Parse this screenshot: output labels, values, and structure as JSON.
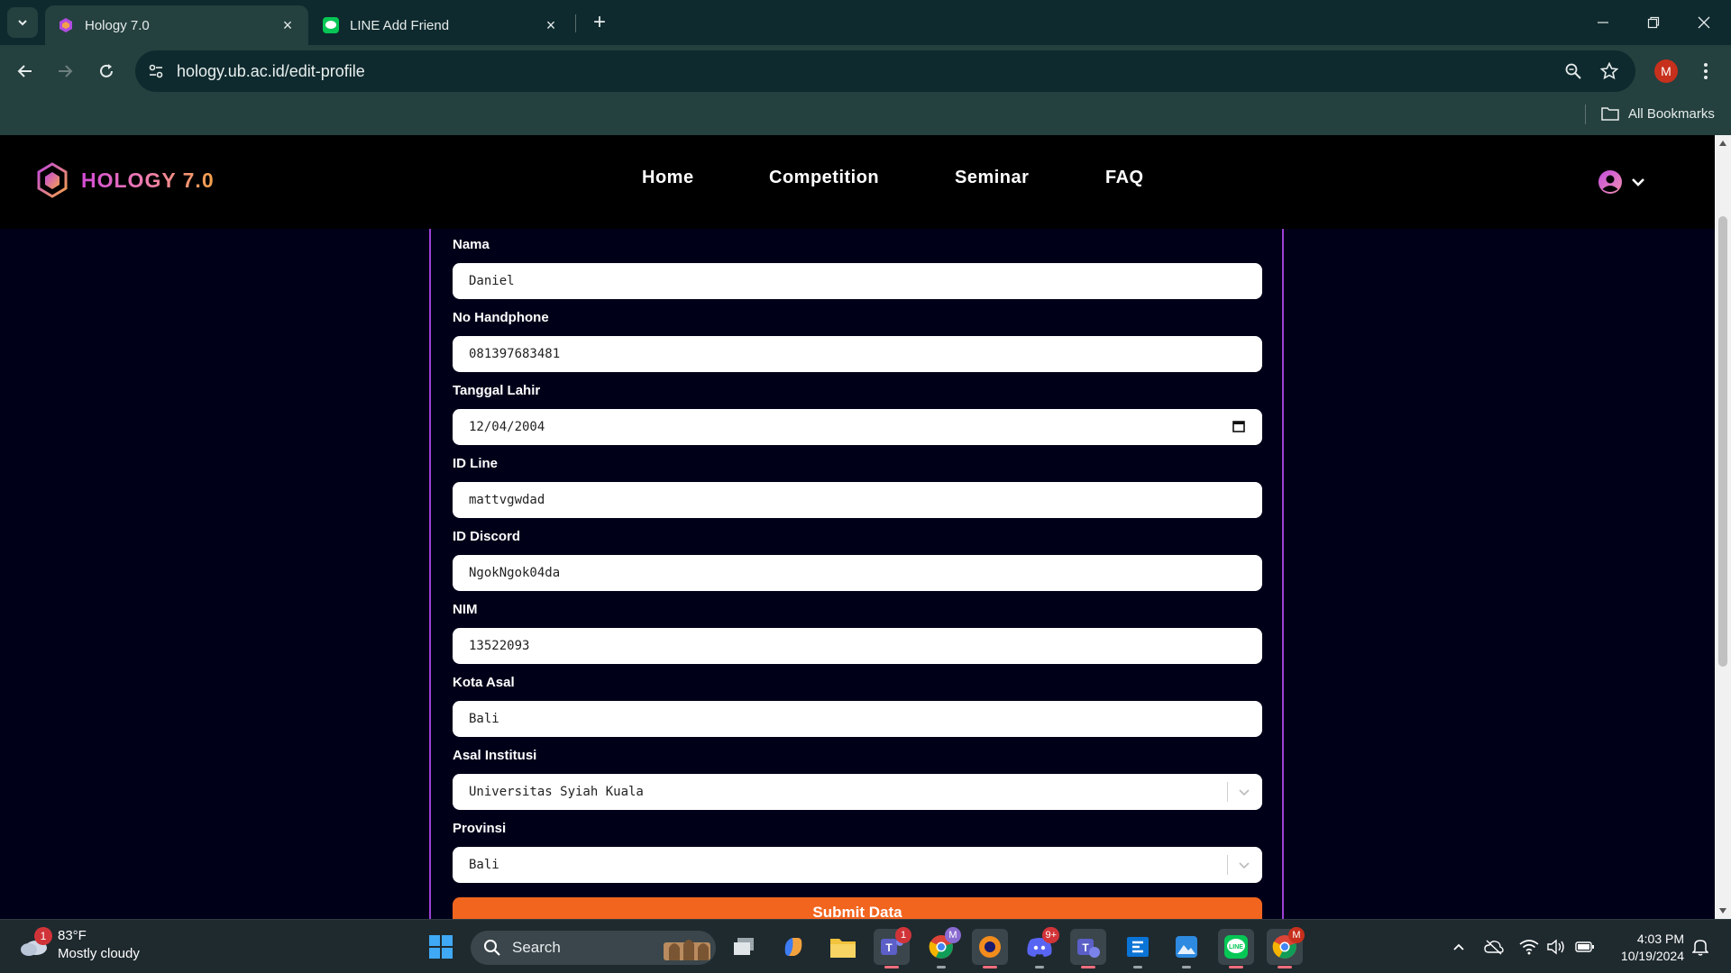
{
  "browser": {
    "tabs": [
      {
        "title": "Hology 7.0",
        "active": true
      },
      {
        "title": "LINE Add Friend",
        "active": false
      }
    ],
    "url": "hology.ub.ac.id/edit-profile",
    "profile_initial": "M",
    "bookmarks_label": "All Bookmarks"
  },
  "site": {
    "brand": "HOLOGY 7.0",
    "nav": [
      {
        "label": "Home"
      },
      {
        "label": "Competition"
      },
      {
        "label": "Seminar"
      },
      {
        "label": "FAQ"
      }
    ]
  },
  "form": {
    "fields": [
      {
        "label": "Nama",
        "value": "Daniel"
      },
      {
        "label": "No Handphone",
        "value": "081397683481"
      },
      {
        "label": "Tanggal Lahir",
        "value": "12/04/2004"
      },
      {
        "label": "ID Line",
        "value": "mattvgwdad"
      },
      {
        "label": "ID Discord",
        "value": "NgokNgok04da"
      },
      {
        "label": "NIM",
        "value": "13522093"
      },
      {
        "label": "Kota Asal",
        "value": "Bali"
      },
      {
        "label": "Asal Institusi",
        "value": "Universitas Syiah Kuala"
      },
      {
        "label": "Provinsi",
        "value": "Bali"
      }
    ],
    "submit_label": "Submit Data"
  },
  "taskbar": {
    "weather": {
      "temp": "83°F",
      "desc": "Mostly cloudy",
      "badge": "1"
    },
    "search_label": "Search",
    "teams_badge": "1",
    "discord_badge": "9+",
    "chrome_badge": "M",
    "time": "4:03 PM",
    "date": "10/19/2024"
  },
  "colors": {
    "page_bg": "#000019",
    "card_border": "#9d3fd6",
    "submit": "#f2651f",
    "chrome_dark": "#0f2a2e",
    "chrome_light": "#24403f"
  }
}
